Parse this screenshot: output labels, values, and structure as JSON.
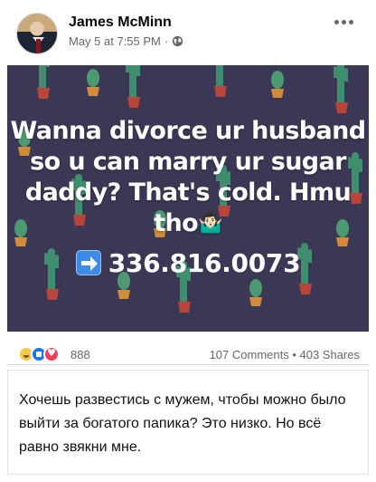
{
  "post": {
    "author": "James McMinn",
    "timestamp": "May 5 at 7:55 PM",
    "separator": "·",
    "privacy_icon": "globe-icon",
    "more_icon": "more-options-icon"
  },
  "image": {
    "main_text": "Wanna divorce ur husband so u can marry ur sugar daddy? That's cold. Hmu tho",
    "emoji": "🤷🏻‍♂️",
    "phone": "336.816.0073",
    "arrow_icon": "right-arrow-icon",
    "background_color": "#3a3854"
  },
  "reactions": {
    "types": [
      "haha",
      "like",
      "love"
    ],
    "count": "888",
    "comments_shares": "107 Comments • 403 Shares"
  },
  "translation": {
    "text": "Хочешь развестись с мужем, чтобы можно было выйти за богатого папика? Это низко. Но всё равно звякни мне."
  }
}
